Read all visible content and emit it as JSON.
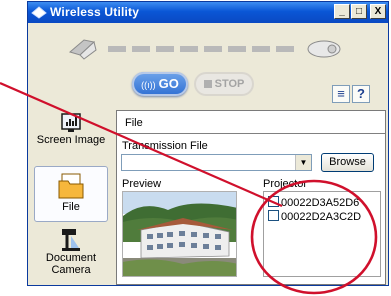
{
  "window": {
    "title": "Wireless Utility",
    "minimize": "_",
    "maximize": "□",
    "close": "X"
  },
  "toolbar": {
    "go_label": "GO",
    "go_signal": "((ı))",
    "stop_label": "STOP",
    "help_label": "?",
    "list_label": "≡"
  },
  "sidebar": {
    "items": [
      {
        "label": "Screen Image",
        "icon": "screen-image-icon"
      },
      {
        "label": "File",
        "icon": "file-icon",
        "active": true
      },
      {
        "label": "Document",
        "label2": "Camera",
        "icon": "document-camera-icon"
      }
    ]
  },
  "panel": {
    "file_label": "File",
    "transmission_label": "Transmission File",
    "file_value": "",
    "browse_label": "Browse",
    "preview_label": "Preview",
    "projector_label": "Projector",
    "projectors": [
      {
        "id": "00022D3A52D6",
        "checked": false
      },
      {
        "id": "00022D2A3C2D",
        "checked": false
      }
    ]
  },
  "annotation": {
    "color": "#d0102c"
  }
}
